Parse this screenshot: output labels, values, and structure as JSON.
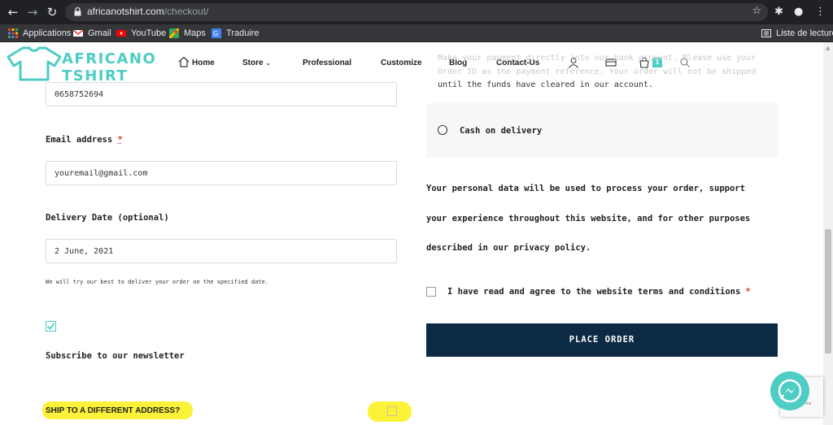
{
  "browser": {
    "url_host": "africanotshirt.com",
    "url_path": "/checkout/",
    "bookmarks": [
      "Applications",
      "Gmail",
      "YouTube",
      "Maps",
      "Traduire"
    ],
    "reading_list": "Liste de lecture"
  },
  "site": {
    "logo_line1": "AFRICANO",
    "logo_line2": "TSHIRT",
    "menu": [
      "Home",
      "Store",
      "Professional",
      "Customize",
      "Blog",
      "Contact-Us"
    ],
    "cart_count": "1",
    "colors": {
      "accent": "#4ecdc4",
      "button": "#0c2a44",
      "highlight": "#fdf23a"
    }
  },
  "form": {
    "phone_value": "0658752694",
    "email_label": "Email address",
    "required_mark": "*",
    "email_value": "youremail@gmail.com",
    "delivery_label": "Delivery Date (optional)",
    "delivery_value": "2 June, 2021",
    "delivery_note": "We will try our best to deliver your order on the specified date.",
    "newsletter_label": "Subscribe to our newsletter",
    "ship_label": "SHIP TO A DIFFERENT ADDRESS?"
  },
  "payment": {
    "bank_line1": "Make your payment directly into our bank account. Please use your",
    "bank_line2": "Order ID as the payment reference. Your order will not be shipped",
    "bank_line3": "until the funds have cleared in our account.",
    "cod_label": "Cash on delivery",
    "privacy_line1": "Your personal data will be used to process your order, support",
    "privacy_line2": "your experience throughout this website, and for other purposes",
    "privacy_line3": "described in our privacy policy.",
    "terms_label": "I have read and agree to the website terms and conditions",
    "terms_required": "*",
    "place_order": "PLACE ORDER"
  },
  "recaptcha": {
    "text": "Privacy - Terms"
  }
}
